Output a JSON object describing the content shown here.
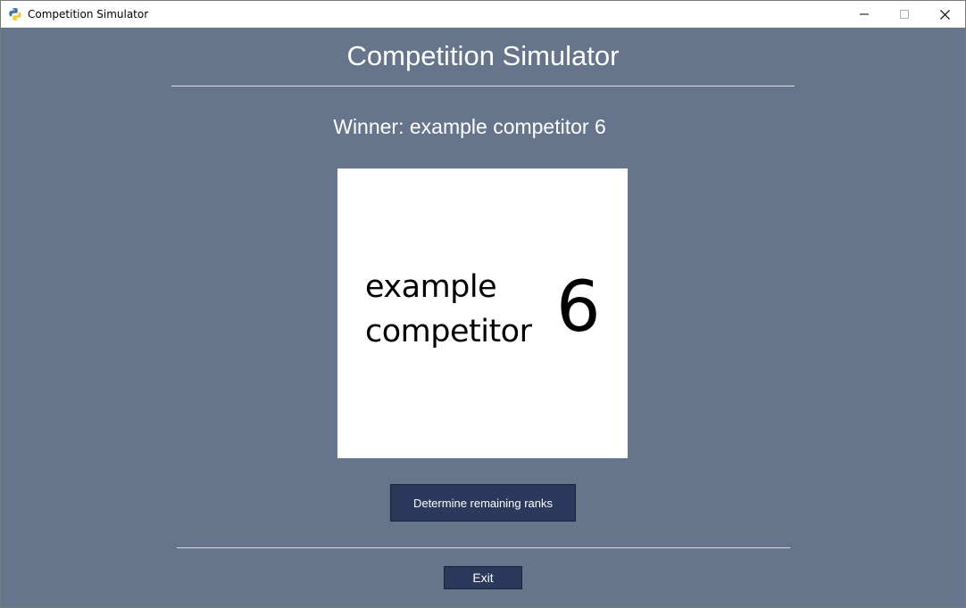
{
  "window": {
    "title": "Competition Simulator",
    "app_icon": "python-icon",
    "controls": {
      "minimize_icon": "minimize-icon",
      "maximize_icon": "maximize-icon",
      "close_icon": "close-icon"
    }
  },
  "main": {
    "heading": "Competition Simulator",
    "winner_text": "Winner: example competitor 6",
    "winner_image": {
      "name_line1": "example",
      "name_line2": "competitor",
      "number": "6"
    },
    "rank_button_label": "Determine remaining ranks",
    "exit_button_label": "Exit"
  },
  "colors": {
    "background": "#66758c",
    "button": "#2b3a5c",
    "text": "#ffffff"
  }
}
